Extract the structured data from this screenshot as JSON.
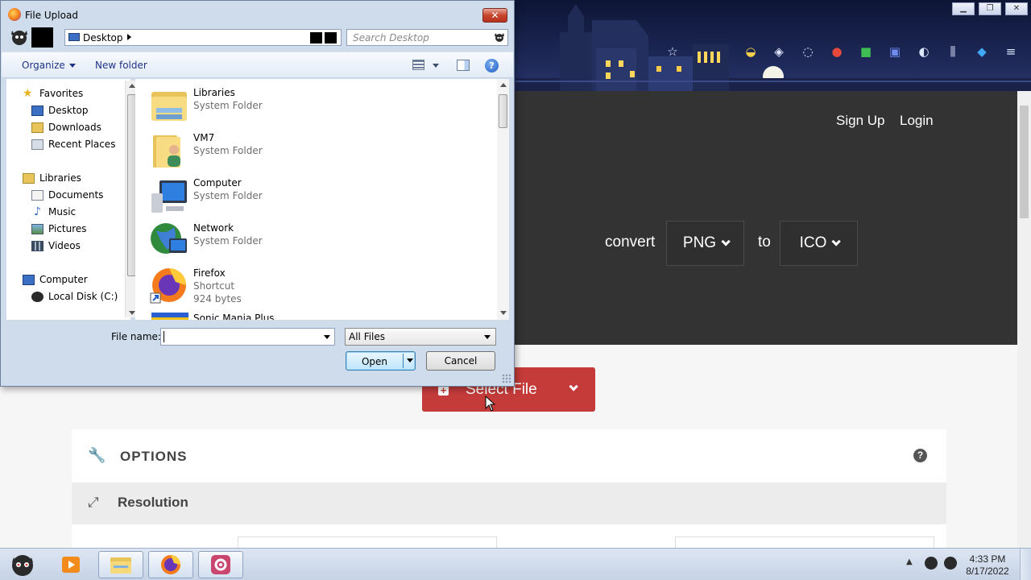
{
  "browser": {
    "nav": {
      "signup": "Sign Up",
      "login": "Login"
    },
    "converter": {
      "convert_label": "convert",
      "from_format": "PNG",
      "to_label": "to",
      "to_format": "ICO",
      "select_file": "Select File"
    },
    "options": {
      "title": "OPTIONS",
      "help": "?",
      "resolution": "Resolution"
    }
  },
  "dialog": {
    "title": "File Upload",
    "close": "✕",
    "address": "Desktop",
    "search_placeholder": "Search Desktop",
    "organize": "Organize",
    "new_folder": "New folder",
    "help": "?",
    "nav": {
      "favorites": "Favorites",
      "favorites_items": [
        "Desktop",
        "Downloads",
        "Recent Places"
      ],
      "libraries": "Libraries",
      "libraries_items": [
        "Documents",
        "Music",
        "Pictures",
        "Videos"
      ],
      "computer": "Computer",
      "computer_items": [
        "Local Disk (C:)"
      ]
    },
    "files": [
      {
        "name": "Libraries",
        "type": "System Folder"
      },
      {
        "name": "VM7",
        "type": "System Folder"
      },
      {
        "name": "Computer",
        "type": "System Folder"
      },
      {
        "name": "Network",
        "type": "System Folder"
      },
      {
        "name": "Firefox",
        "type": "Shortcut",
        "size": "924 bytes"
      },
      {
        "name": "Sonic Mania Plus",
        "type": ""
      }
    ],
    "file_name_label": "File name:",
    "file_name_value": "",
    "filter": "All Files",
    "open": "Open",
    "cancel": "Cancel"
  },
  "taskbar": {
    "time": "4:33 PM",
    "date": "8/17/2022"
  },
  "colors": {
    "hero_bg": "#333333",
    "select_file": "#c43b3a",
    "dialog_frame": "#cfdcec"
  }
}
